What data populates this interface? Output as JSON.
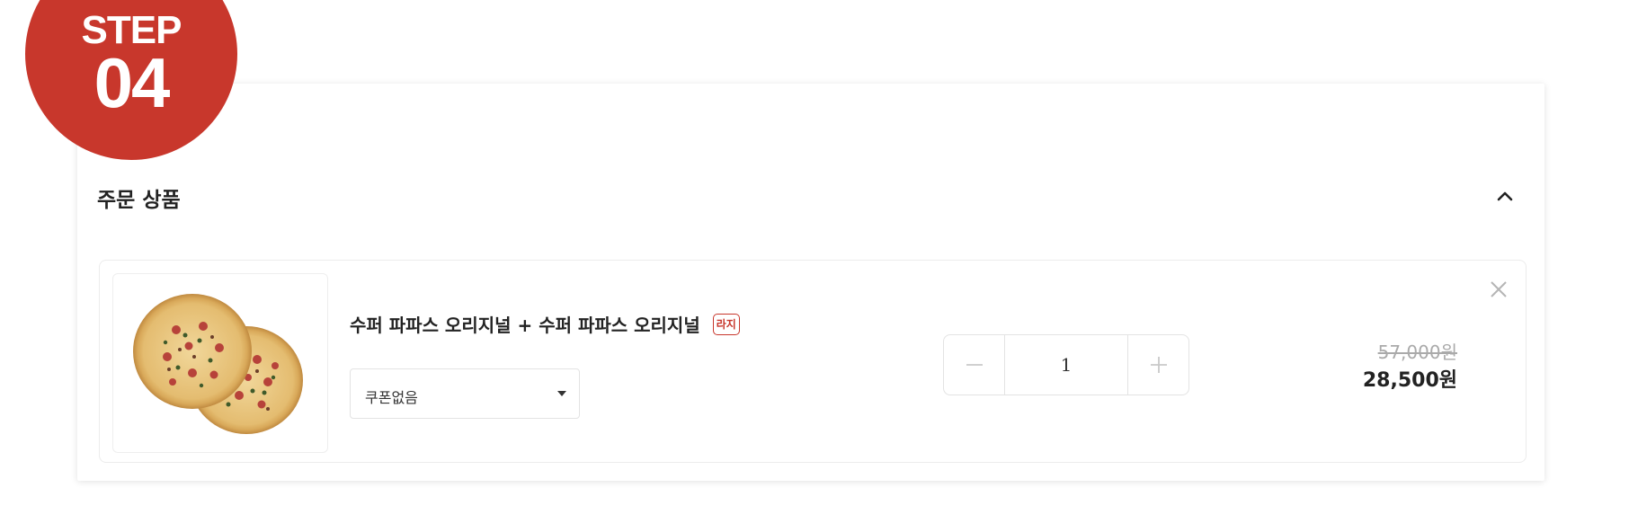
{
  "step": {
    "label": "STEP",
    "number": "04"
  },
  "section": {
    "title": "주문 상품",
    "collapse_icon": "chevron-up-icon"
  },
  "item": {
    "name": "수퍼 파파스 오리지널 + 수퍼 파파스 오리지널",
    "size_badge": "라지",
    "coupon": {
      "selected": "쿠폰없음"
    },
    "quantity": "1",
    "price_original": "57,000원",
    "price_final": "28,500원",
    "remove_icon": "close-icon",
    "image_icon": "pizza-image"
  },
  "colors": {
    "accent": "#c8372c",
    "text": "#222222",
    "muted": "#aaaaaa",
    "border": "#e3e3e3"
  }
}
